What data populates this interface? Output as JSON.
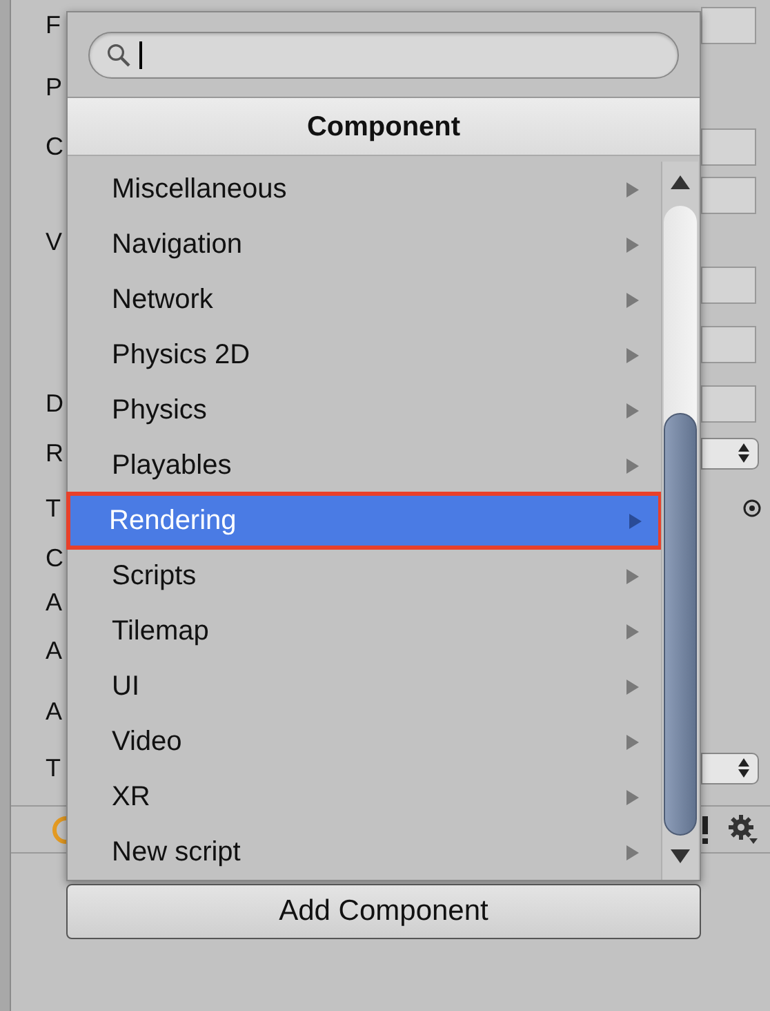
{
  "inspector": {
    "rows": [
      {
        "label": "F",
        "kind": "field"
      },
      {
        "label": "P",
        "kind": "plain"
      },
      {
        "label": "C",
        "kind": "field"
      },
      {
        "kind": "field"
      },
      {
        "label": "V",
        "kind": "plain"
      },
      {
        "kind": "field"
      },
      {
        "kind": "field"
      },
      {
        "label": "D",
        "kind": "field"
      },
      {
        "label": "R",
        "kind": "dropdown"
      },
      {
        "label": "T",
        "kind": "object"
      },
      {
        "label": "C",
        "kind": "plain"
      },
      {
        "label": "A",
        "kind": "plain"
      },
      {
        "label": "A",
        "kind": "plain"
      },
      {
        "label": "A",
        "kind": "plain"
      },
      {
        "label": "T",
        "kind": "dropdown"
      }
    ]
  },
  "popup": {
    "title": "Component",
    "items": [
      {
        "label": "Miscellaneous",
        "selected": false
      },
      {
        "label": "Navigation",
        "selected": false
      },
      {
        "label": "Network",
        "selected": false
      },
      {
        "label": "Physics 2D",
        "selected": false
      },
      {
        "label": "Physics",
        "selected": false
      },
      {
        "label": "Playables",
        "selected": false
      },
      {
        "label": "Rendering",
        "selected": true
      },
      {
        "label": "Scripts",
        "selected": false
      },
      {
        "label": "Tilemap",
        "selected": false
      },
      {
        "label": "UI",
        "selected": false
      },
      {
        "label": "Video",
        "selected": false
      },
      {
        "label": "XR",
        "selected": false
      },
      {
        "label": "New script",
        "selected": false
      }
    ]
  },
  "add_button": "Add Component"
}
